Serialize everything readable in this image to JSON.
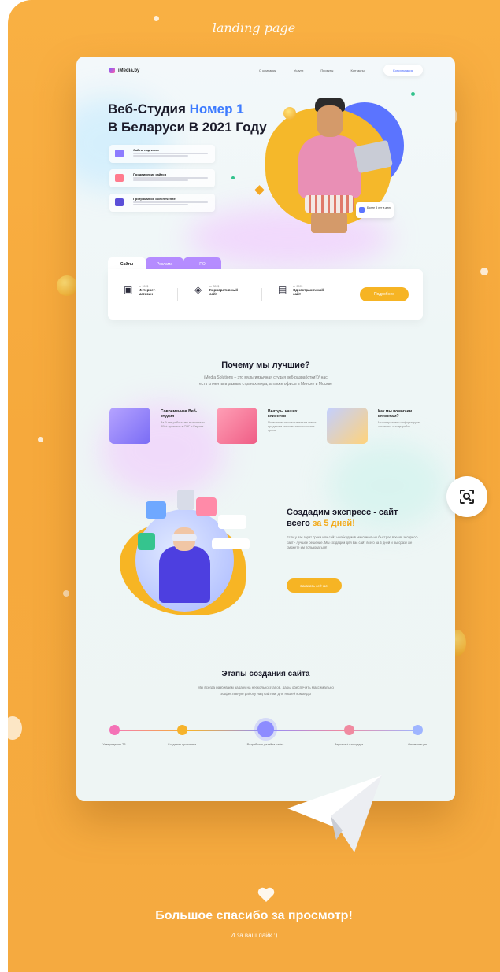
{
  "script_title": "landing page",
  "nav": {
    "logo": "iMedia.by",
    "menu": [
      "О компании",
      "Услуги",
      "Проекты",
      "Контакты"
    ],
    "cta": "Консультация"
  },
  "hero": {
    "title_part1": "Веб-Студия ",
    "title_accent": "Номер 1",
    "title_line2": "В Беларуси В 2021 Году",
    "features": [
      {
        "title": "Сайты под ключ"
      },
      {
        "title": "Продвижение сайтов"
      },
      {
        "title": "Программное обеспечение"
      }
    ],
    "badge": "Более 3 лет в деле"
  },
  "tabs": [
    "Сайты",
    "Реклама",
    "ПО"
  ],
  "services": [
    {
      "price": "от 100$",
      "name": "Интернет-магазин",
      "icon": "store-icon"
    },
    {
      "price": "от 300$",
      "name": "Корпоративный сайт",
      "icon": "layers-icon"
    },
    {
      "price": "от 200$",
      "name": "Одностраничный сайт",
      "icon": "window-icon"
    }
  ],
  "more_button": "Подробнее",
  "why": {
    "title": "Почему мы лучшие?",
    "subtitle_line1": "iMedia Solutions – это мультиязычная студия веб-разработки! У нас",
    "subtitle_line2": "есть клиенты в разных странах мира, а также офисы в Минске и Москве",
    "cards": [
      {
        "title": "Современная Веб-студия",
        "text": "За 9 лет работы мы выполнили 300+ проектов в СНГ и Европе."
      },
      {
        "title": "Выгоды наших клиентов",
        "text": "Позволяем нашим клиентам иметь продажи в максимально короткие сроки"
      },
      {
        "title": "Как мы помогаем клиентам?",
        "text": "Мы оперативно информируем заказчика о ходе работ."
      }
    ]
  },
  "express": {
    "title_line1": "Создадим экспресс - сайт",
    "title_prefix": "всего ",
    "title_accent": "за 5 дней!",
    "text": "Если у вас горят сроки или сайт необходим в максимально быстрое время, экспресс-сайт - лучшее решение. Мы создадим для вас сайт всего за 5 дней и вы сразу же сможете им пользоваться!",
    "button": "Заказать сейчас!"
  },
  "stages": {
    "title": "Этапы создания сайта",
    "subtitle_line1": "Мы всегда разбиваем задачу на несколько этапов, дабы обеспечить максимально",
    "subtitle_line2": "эффективную работу над сайтом, для нашей команды",
    "items": [
      {
        "label": "Утверждение ТЗ",
        "color": "#f472b6"
      },
      {
        "label": "Создание прототипа",
        "color": "#f6b32b"
      },
      {
        "label": "Разработка дизайна сайта",
        "color": "#8d8cff"
      },
      {
        "label": "Верстка + площадка",
        "color": "#f08aa0"
      },
      {
        "label": "Оптимизация",
        "color": "#9fb5ff"
      }
    ]
  },
  "footer": {
    "thanks": "Большое спасибо за просмотр!",
    "like": "И за ваш лайк :)"
  },
  "colors": {
    "background_orange": "#f6a93c",
    "accent_blue": "#3d7bff",
    "accent_yellow": "#f6b424",
    "tab_purple": "#b58cff"
  }
}
